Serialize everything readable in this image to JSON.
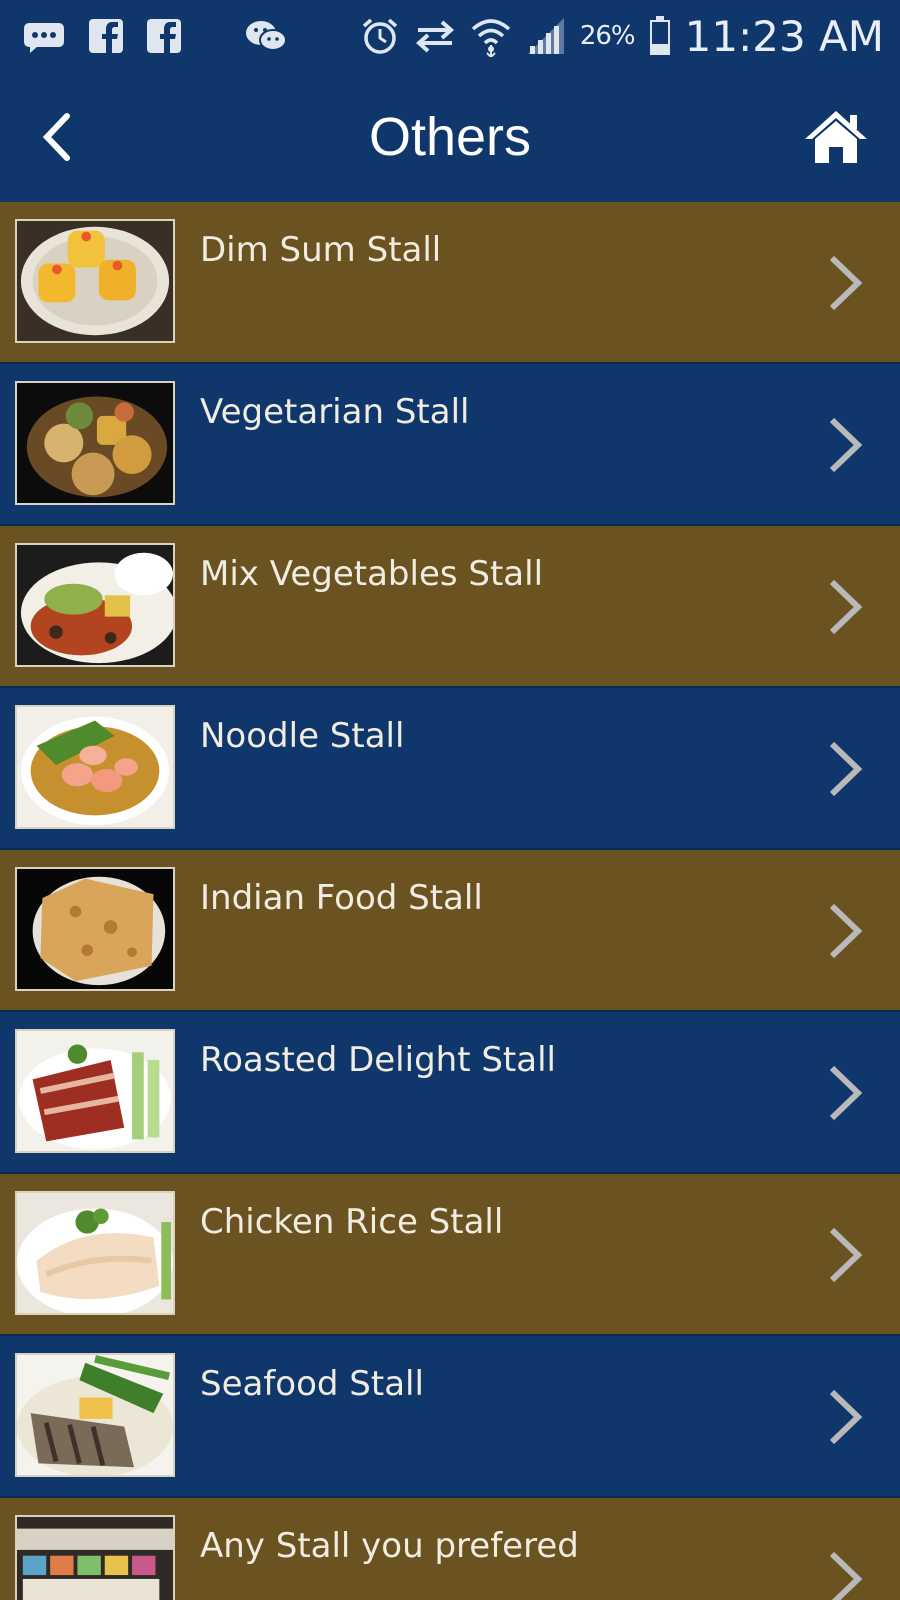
{
  "status_bar": {
    "battery": "26%",
    "time": "11:23 AM",
    "icons": [
      "message-icon",
      "facebook-icon",
      "facebook-icon",
      "wechat-icon",
      "alarm-icon",
      "data-transfer-icon",
      "wifi-icon",
      "signal-icon",
      "battery-icon"
    ]
  },
  "header": {
    "title": "Others",
    "back_icon": "chevron-left-icon",
    "home_icon": "home-icon"
  },
  "stalls": [
    {
      "label": "Dim Sum Stall",
      "thumb": "dim-sum-photo"
    },
    {
      "label": "Vegetarian Stall",
      "thumb": "vegetarian-photo"
    },
    {
      "label": "Mix Vegetables Stall",
      "thumb": "mix-vegetables-photo"
    },
    {
      "label": "Noodle Stall",
      "thumb": "noodle-photo"
    },
    {
      "label": "Indian Food Stall",
      "thumb": "indian-food-photo"
    },
    {
      "label": "Roasted Delight Stall",
      "thumb": "roasted-delight-photo"
    },
    {
      "label": "Chicken Rice Stall",
      "thumb": "chicken-rice-photo"
    },
    {
      "label": "Seafood Stall",
      "thumb": "seafood-photo"
    },
    {
      "label": "Any Stall you prefered",
      "thumb": "stall-front-photo"
    }
  ],
  "colors": {
    "navy": "#0f376b",
    "gold": "#6b5221",
    "chevron": "#b9b9b9"
  }
}
